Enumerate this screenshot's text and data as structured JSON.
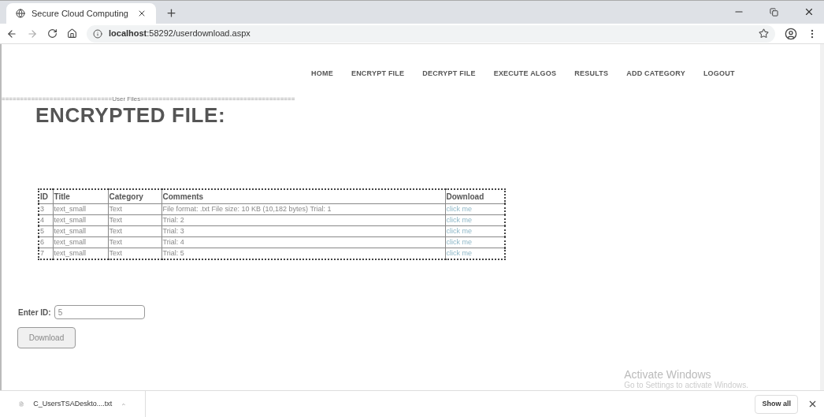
{
  "browser": {
    "tab": {
      "title": "Secure Cloud Computing",
      "selected": true
    },
    "address": {
      "host": "localhost",
      "path": ":58292/userdownload.aspx"
    }
  },
  "nav": [
    {
      "label": "HOME"
    },
    {
      "label": "ENCRYPT FILE"
    },
    {
      "label": "DECRYPT FILE"
    },
    {
      "label": "EXECUTE ALGOS"
    },
    {
      "label": "RESULTS"
    },
    {
      "label": "ADD CATEGORY"
    },
    {
      "label": "LOGOUT"
    }
  ],
  "section_divider": "==============================User Files==========================================",
  "heading": "ENCRYPTED FILE:",
  "table": {
    "columns": [
      "ID",
      "Title",
      "Category",
      "Comments",
      "Download"
    ],
    "rows": [
      [
        "3",
        "text_small",
        "Text",
        "File format: .txt File size: 10 KB (10,182 bytes) Trial: 1",
        "click me"
      ],
      [
        "4",
        "text_small",
        "Text",
        "Trial: 2",
        "click me"
      ],
      [
        "5",
        "text_small",
        "Text",
        "Trial: 3",
        "click me"
      ],
      [
        "6",
        "text_small",
        "Text",
        "Trial: 4",
        "click me"
      ],
      [
        "7",
        "text_small",
        "Text",
        "Trial: 5",
        "click me"
      ]
    ]
  },
  "id_field": {
    "label": "Enter ID:",
    "value": "5"
  },
  "download_button": "Download",
  "activation_notice": {
    "title": "Activate Windows",
    "subtitle": "Go to Settings to activate Windows."
  },
  "downloads_bar": {
    "file": "C_UsersTSADeskto....txt",
    "show_all": "Show all"
  }
}
